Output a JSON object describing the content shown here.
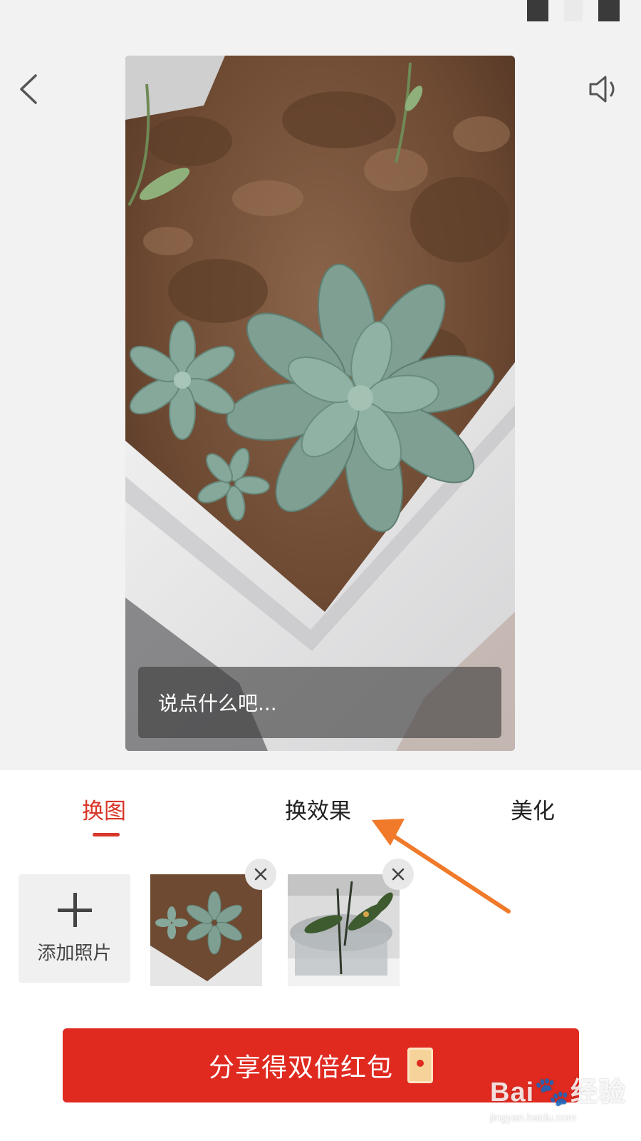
{
  "status_bar": {},
  "nav": {
    "back_icon": "chevron-left-icon",
    "sound_icon": "speaker-icon"
  },
  "preview": {
    "image_subject": "succulent in foam planter",
    "caption_placeholder": "说点什么吧..."
  },
  "tabs": [
    {
      "label": "换图",
      "active": true
    },
    {
      "label": "换效果",
      "active": false
    },
    {
      "label": "美化",
      "active": false
    }
  ],
  "photos": {
    "add_label": "添加照片",
    "thumbnails": [
      {
        "subject": "succulent"
      },
      {
        "subject": "plant in glass vase"
      }
    ],
    "remove_icon": "close-icon"
  },
  "share_button": {
    "label": "分享得双倍红包",
    "icon": "red-envelope-icon"
  },
  "annotation": {
    "arrow_color": "#f07a2a"
  },
  "watermark": {
    "logo": "Bai经验",
    "site": "jingyan.baidu.com"
  },
  "colors": {
    "accent": "#d8372a",
    "button": "#e02a20",
    "background": "#f2f2f2"
  }
}
